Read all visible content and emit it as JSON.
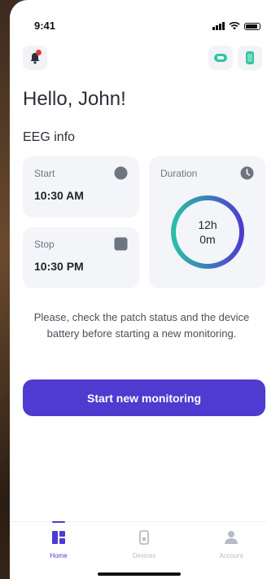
{
  "status_bar": {
    "time": "9:41"
  },
  "greeting": "Hello, John!",
  "section_title": "EEG info",
  "start": {
    "label": "Start",
    "value": "10:30 AM"
  },
  "stop": {
    "label": "Stop",
    "value": "10:30 PM"
  },
  "duration": {
    "label": "Duration",
    "hours_text": "12h",
    "minutes_text": "0m",
    "progress": 1.0
  },
  "description": "Please, check the patch status and the device battery before starting a new monitoring.",
  "cta_label": "Start new monitoring",
  "tabs": [
    {
      "label": "Home",
      "icon": "home-icon",
      "active": true
    },
    {
      "label": "Devices",
      "icon": "device-icon",
      "active": false
    },
    {
      "label": "Account",
      "icon": "user-icon",
      "active": false
    }
  ],
  "colors": {
    "accent": "#4f3bd0",
    "ring_start": "#2bbfa8",
    "ring_end": "#4f3bd0",
    "alert": "#e53935"
  }
}
